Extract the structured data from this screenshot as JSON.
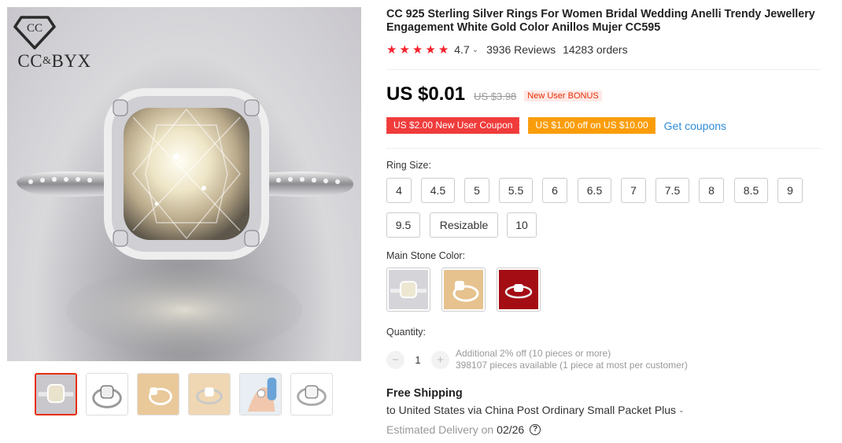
{
  "brand": {
    "logo_text_left": "CC",
    "logo_text_amp": "&",
    "logo_text_right": "BYX",
    "monogram": "CC"
  },
  "product": {
    "title": "CC 925 Sterling Silver Rings For Women Bridal Wedding Anelli Trendy Jewellery Engagement White Gold Color Anillos Mujer CC595",
    "rating_value": "4.7",
    "rating_stars": 5,
    "reviews": "3936 Reviews",
    "orders": "14283 orders"
  },
  "price": {
    "current": "US $0.01",
    "original": "US $3.98",
    "bonus_tag": "New User BONUS"
  },
  "coupons": {
    "items": [
      {
        "label": "US $2.00 New User Coupon",
        "color": "#f03b3b"
      },
      {
        "label": "US $1.00 off on US $10.00",
        "color": "#fa9d0b"
      }
    ],
    "get_label": "Get coupons"
  },
  "ring_size": {
    "label": "Ring Size:",
    "options": [
      "4",
      "4.5",
      "5",
      "5.5",
      "6",
      "6.5",
      "7",
      "7.5",
      "8",
      "8.5",
      "9",
      "9.5",
      "Resizable",
      "10"
    ]
  },
  "stone_color": {
    "label": "Main Stone Color:"
  },
  "quantity": {
    "label": "Quantity:",
    "value": "1",
    "minus": "−",
    "plus": "+",
    "discount_note": "Additional 2% off (10 pieces or more)",
    "stock_note": "398107 pieces available (1 piece at most per customer)"
  },
  "shipping": {
    "title": "Free Shipping",
    "route": "to United States via China Post Ordinary Small Packet Plus",
    "delivery_label": "Estimated Delivery on",
    "delivery_date": "02/26",
    "help": "?"
  },
  "colors": {
    "accent_red": "#e62e04",
    "star_red": "#f5222d",
    "link_blue": "#2e8cd8"
  }
}
